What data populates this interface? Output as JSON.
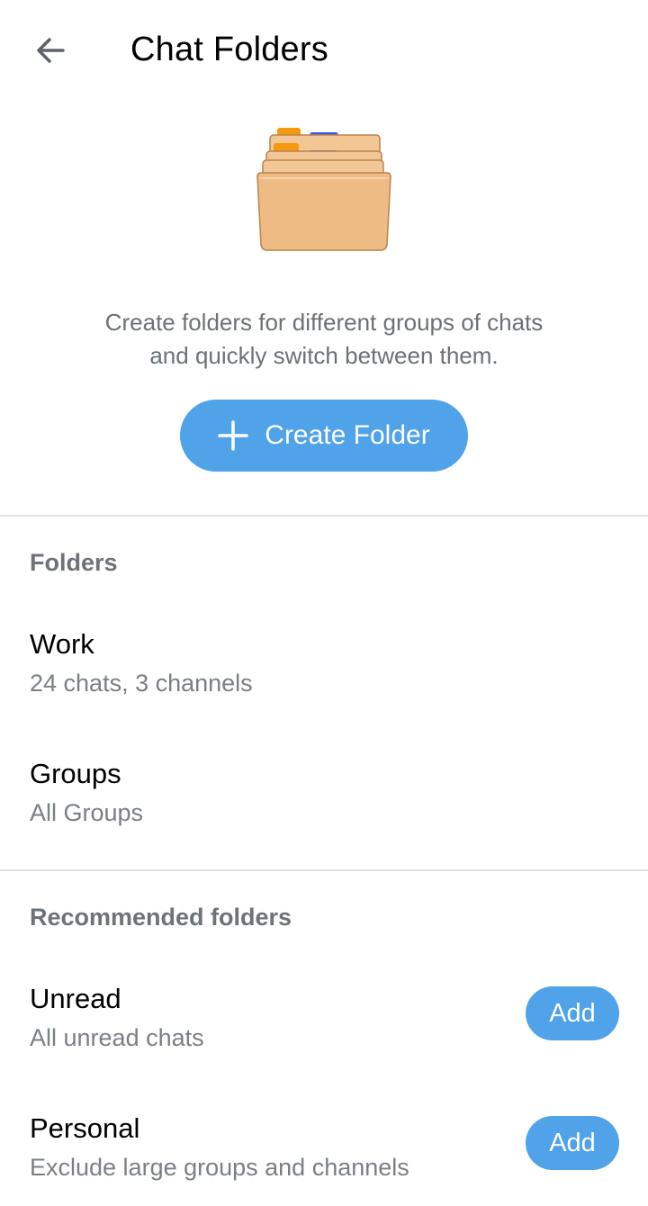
{
  "header": {
    "title": "Chat Folders",
    "back_icon": "arrow-left-icon"
  },
  "intro": {
    "line1": "Create folders for different groups of chats",
    "line2": "and quickly switch between them."
  },
  "create_button": {
    "label": "Create Folder",
    "icon": "plus-icon",
    "color": "#50a2e9"
  },
  "folders": {
    "header": "Folders",
    "items": [
      {
        "name": "Work",
        "subtitle": "24 chats, 3 channels"
      },
      {
        "name": "Groups",
        "subtitle": "All Groups"
      }
    ]
  },
  "recommended": {
    "header": "Recommended folders",
    "items": [
      {
        "name": "Unread",
        "subtitle": "All unread chats",
        "action": "Add"
      },
      {
        "name": "Personal",
        "subtitle": "Exclude large groups and channels",
        "action": "Add"
      }
    ]
  },
  "colors": {
    "accent": "#50a2e9",
    "secondary_text": "#7a7f84",
    "divider": "#dfe1e4"
  }
}
